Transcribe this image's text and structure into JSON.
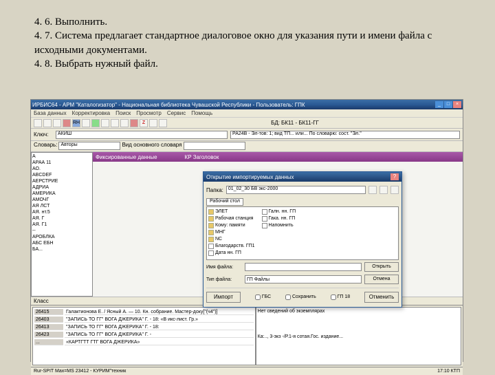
{
  "instructions": {
    "line1": "4. 6. Выполнить.",
    "line2": " 4. 7. Система предлагает стандартное диалоговое окно для указания пути и имени файла с исходными документами.",
    "line3": "4. 8. Выбрать нужный файл."
  },
  "app": {
    "title": "ИРБИС64 - АРМ \"Каталогизатор\" - Национальная библиотека Чувашской Республики - Пользователь: ГПК",
    "menus": [
      "База данных",
      "Корректировка",
      "Поиск",
      "Просмотр",
      "Сервис",
      "Помощь"
    ],
    "toolbar_z": "Z",
    "db_label": "БД:",
    "db_value": "БК11 - БК11-ГГ",
    "phrase_label": "Ключ:",
    "phrase_value": "АКИШ",
    "result_label": "РА24В - Эл-тов: 1; вид ТП... или... По словарю: сост. \"Эл.\"",
    "dict_label": "Словарь:",
    "dict_value": "Авторы",
    "view_label": "Вид основного словаря",
    "tab1_label": "Фиксированные данные",
    "tab2_label": "КР Заголовок",
    "dict_items": [
      "А",
      "АРАА 11",
      "АО.",
      "ABCDEF",
      "АЕРСТРИЕ",
      "АДРИА",
      "АМЕРИКА",
      "АМОЧГ",
      "АЯ ЛСТ",
      "АЯ. нт.5",
      "АЯ. Г",
      "АЯ. Г1",
      "--",
      "АРОБЛКА",
      "АБС ЕБН",
      "БА..."
    ],
    "class_label": "Класс",
    "records": [
      {
        "id": "26415",
        "text": "Галактионова Е. / Ясный А. — 10. Кн. собрание. Мастер-доку[\"(ч4\")]"
      },
      {
        "id": "26403",
        "text": "\"ЗАПИСЬ ТО ГГ\" ВОГА ДЖЕРИКА\" Г. - 18: «В икс-лист. Гр.»"
      },
      {
        "id": "26413",
        "text": "\"ЗАПИСЬ ТО ГГ\" ВОГА ДЖЕРИКА\" Г. - 18:"
      },
      {
        "id": "26423",
        "text": "\"ЗАПИСЬ ТО ГГ\" ВОГА ДЖЕРИКА\" Г. -"
      },
      {
        "id": "...",
        "text": "«КАРТГТТ ГТГ ВОГА ДЖЕРИКА»"
      }
    ],
    "no_msg": "Нет сведений об экземплярах",
    "bottom_ref": "Ка:.., 3-экз -/Р.1-я сотая.Гос. издание...",
    "status_left": "Rur-SPIT Max=MS 23412 - КУРИМ\"техник",
    "status_right": "17:10 КТП"
  },
  "dialog": {
    "title": "Открытие импортируемых данных",
    "folder_label": "Папка:",
    "folder_value": "01_02_30 БВ экс-2000",
    "file_tab": "Рабочий стол",
    "folders_left": [
      "ЭЛЕТ",
      "Рабочая станция",
      "Кому: памяти",
      "МНГ",
      "NC"
    ],
    "folders_right": [
      "Благодарств. ГП1",
      "Дата нн. ГП",
      "Галн. нн. ГП",
      "Гака. нн. ГП",
      "Напомнить"
    ],
    "name_label": "Имя файла:",
    "name_value": "",
    "type_label": "Тип файла:",
    "type_value": "ГП Файлы",
    "open_btn": "Открыть",
    "cancel_btn": "Отмена",
    "action_import": "Импорт",
    "action_cancel": "Отменить",
    "cbx1": "ГБС",
    "cbx2": "Сохранить",
    "cbx3": "ГП 18"
  }
}
